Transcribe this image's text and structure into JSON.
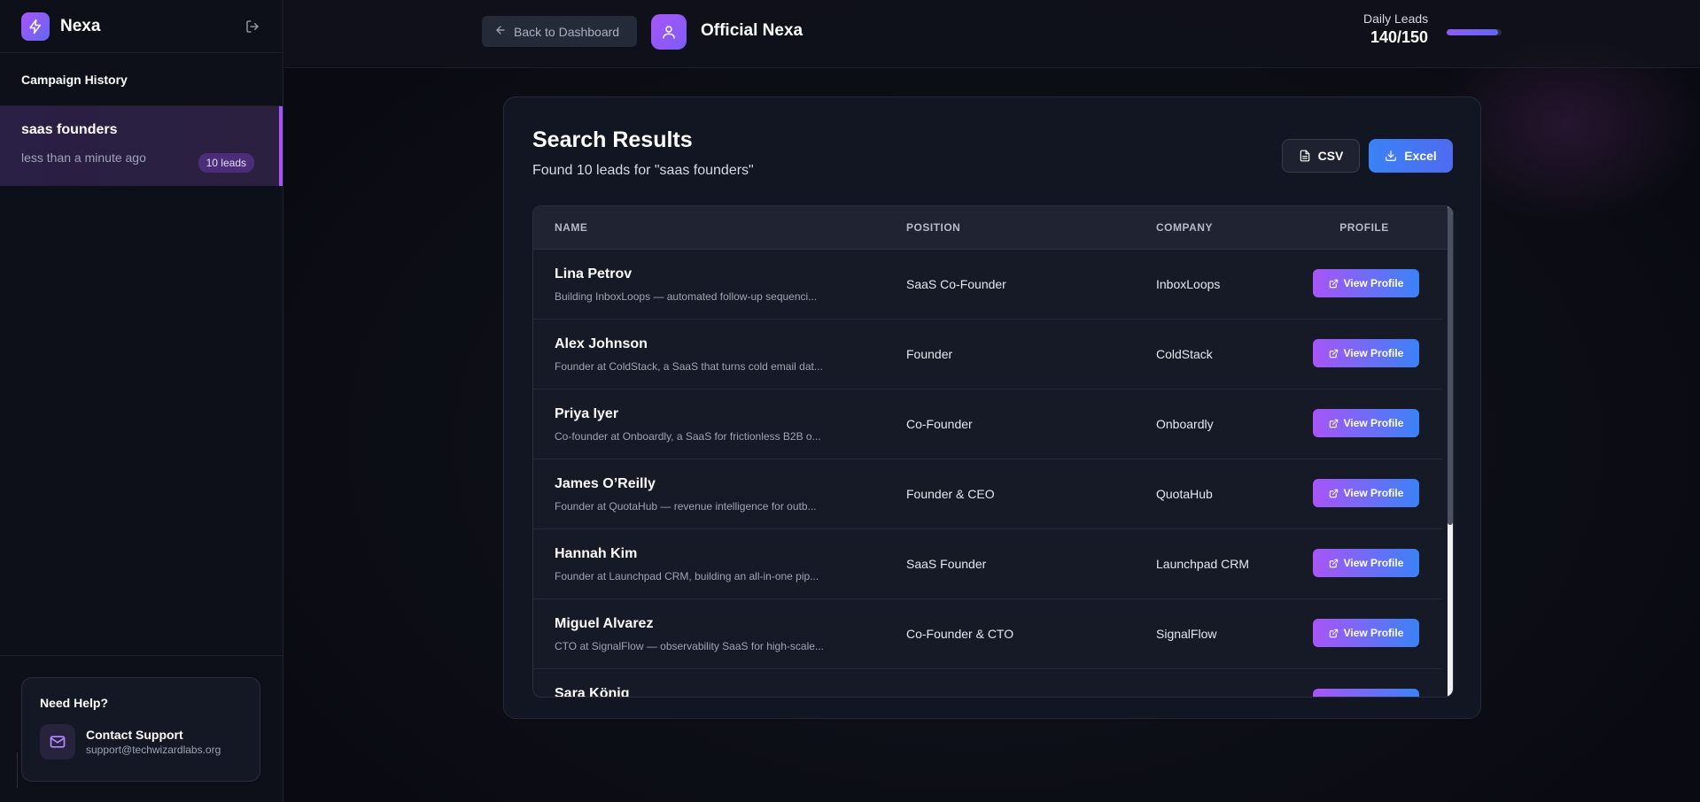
{
  "app": {
    "name": "Nexa"
  },
  "sidebar": {
    "history_title": "Campaign History",
    "campaigns": [
      {
        "name": "saas founders",
        "time": "less than a minute ago",
        "badge": "10 leads"
      }
    ],
    "help": {
      "title": "Need Help?",
      "support_label": "Contact Support",
      "support_email": "support@techwizardlabs.org"
    }
  },
  "header": {
    "back_label": "Back to Dashboard",
    "account_name": "Official Nexa",
    "daily_leads_label": "Daily Leads",
    "daily_leads_value": "140/150",
    "daily_leads_progress": 0.93
  },
  "results": {
    "title": "Search Results",
    "subtitle": "Found 10 leads for \"saas founders\"",
    "csv_label": "CSV",
    "excel_label": "Excel",
    "columns": {
      "name": "NAME",
      "position": "POSITION",
      "company": "COMPANY",
      "profile": "PROFILE"
    },
    "view_label": "View Profile",
    "rows": [
      {
        "name": "Lina Petrov",
        "desc": "Building InboxLoops — automated follow-up sequenci...",
        "position": "SaaS Co-Founder",
        "company": "InboxLoops"
      },
      {
        "name": "Alex Johnson",
        "desc": "Founder at ColdStack, a SaaS that turns cold email dat...",
        "position": "Founder",
        "company": "ColdStack"
      },
      {
        "name": "Priya Iyer",
        "desc": "Co-founder at Onboardly, a SaaS for frictionless B2B o...",
        "position": "Co-Founder",
        "company": "Onboardly"
      },
      {
        "name": "James O’Reilly",
        "desc": "Founder at QuotaHub — revenue intelligence for outb...",
        "position": "Founder & CEO",
        "company": "QuotaHub"
      },
      {
        "name": "Hannah Kim",
        "desc": "Founder at Launchpad CRM, building an all-in-one pip...",
        "position": "SaaS Founder",
        "company": "Launchpad CRM"
      },
      {
        "name": "Miguel Alvarez",
        "desc": "CTO at SignalFlow — observability SaaS for high-scale...",
        "position": "Co-Founder & CTO",
        "company": "SignalFlow"
      },
      {
        "name": "Sara König",
        "desc": "",
        "position": "",
        "company": ""
      }
    ]
  }
}
